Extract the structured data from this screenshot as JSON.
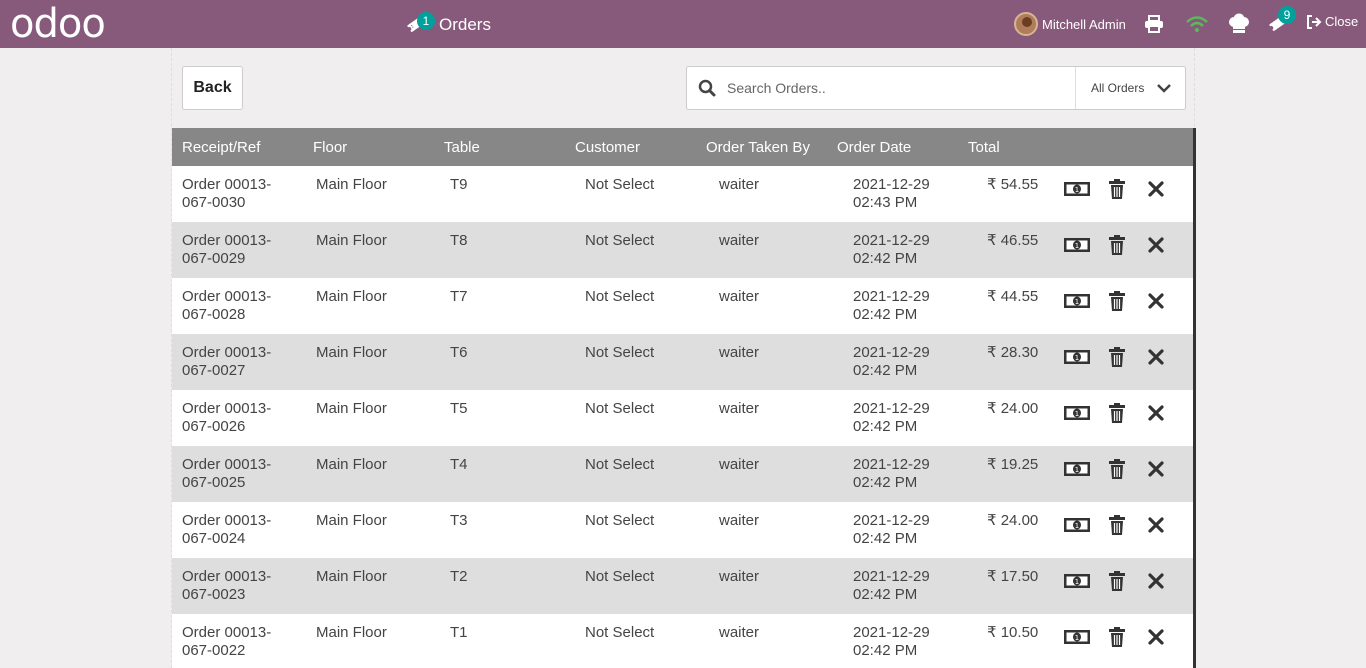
{
  "header": {
    "logo": "odoo",
    "orders_label": "Orders",
    "orders_badge": "1",
    "user_name": "Mitchell Admin",
    "tickets_badge": "9",
    "close_label": "Close"
  },
  "toolbar": {
    "back_label": "Back",
    "search_placeholder": "Search Orders..",
    "filter_label": "All Orders"
  },
  "table": {
    "columns": [
      "Receipt/Ref",
      "Floor",
      "Table",
      "Customer",
      "Order Taken By",
      "Order Date",
      "Total"
    ],
    "rows": [
      {
        "ref1": "Order 00013-",
        "ref2": "067-0030",
        "floor": "Main Floor",
        "table": "T9",
        "customer": "Not Select",
        "taken_by": "waiter",
        "date": "2021-12-29",
        "time": "02:43 PM",
        "total": "₹ 54.55"
      },
      {
        "ref1": "Order 00013-",
        "ref2": "067-0029",
        "floor": "Main Floor",
        "table": "T8",
        "customer": "Not Select",
        "taken_by": "waiter",
        "date": "2021-12-29",
        "time": "02:42 PM",
        "total": "₹ 46.55"
      },
      {
        "ref1": "Order 00013-",
        "ref2": "067-0028",
        "floor": "Main Floor",
        "table": "T7",
        "customer": "Not Select",
        "taken_by": "waiter",
        "date": "2021-12-29",
        "time": "02:42 PM",
        "total": "₹ 44.55"
      },
      {
        "ref1": "Order 00013-",
        "ref2": "067-0027",
        "floor": "Main Floor",
        "table": "T6",
        "customer": "Not Select",
        "taken_by": "waiter",
        "date": "2021-12-29",
        "time": "02:42 PM",
        "total": "₹ 28.30"
      },
      {
        "ref1": "Order 00013-",
        "ref2": "067-0026",
        "floor": "Main Floor",
        "table": "T5",
        "customer": "Not Select",
        "taken_by": "waiter",
        "date": "2021-12-29",
        "time": "02:42 PM",
        "total": "₹ 24.00"
      },
      {
        "ref1": "Order 00013-",
        "ref2": "067-0025",
        "floor": "Main Floor",
        "table": "T4",
        "customer": "Not Select",
        "taken_by": "waiter",
        "date": "2021-12-29",
        "time": "02:42 PM",
        "total": "₹ 19.25"
      },
      {
        "ref1": "Order 00013-",
        "ref2": "067-0024",
        "floor": "Main Floor",
        "table": "T3",
        "customer": "Not Select",
        "taken_by": "waiter",
        "date": "2021-12-29",
        "time": "02:42 PM",
        "total": "₹ 24.00"
      },
      {
        "ref1": "Order 00013-",
        "ref2": "067-0023",
        "floor": "Main Floor",
        "table": "T2",
        "customer": "Not Select",
        "taken_by": "waiter",
        "date": "2021-12-29",
        "time": "02:42 PM",
        "total": "₹ 17.50"
      },
      {
        "ref1": "Order 00013-",
        "ref2": "067-0022",
        "floor": "Main Floor",
        "table": "T1",
        "customer": "Not Select",
        "taken_by": "waiter",
        "date": "2021-12-29",
        "time": "02:42 PM",
        "total": "₹ 10.50"
      }
    ]
  },
  "colors": {
    "topbar": "#875a7b",
    "badge": "#00a09d",
    "header_row": "#878787",
    "wifi": "#5cb85c"
  },
  "icons": {
    "orders_tab": "ticket-icon",
    "printer": "printer-icon",
    "network": "wifi-icon",
    "kitchen": "chef-hat-icon",
    "tickets": "ticket-icon",
    "close": "sign-out-icon",
    "search": "search-icon",
    "filter": "chevron-down-icon",
    "row_pay": "money-icon",
    "row_delete": "trash-icon",
    "row_cancel": "close-icon"
  }
}
